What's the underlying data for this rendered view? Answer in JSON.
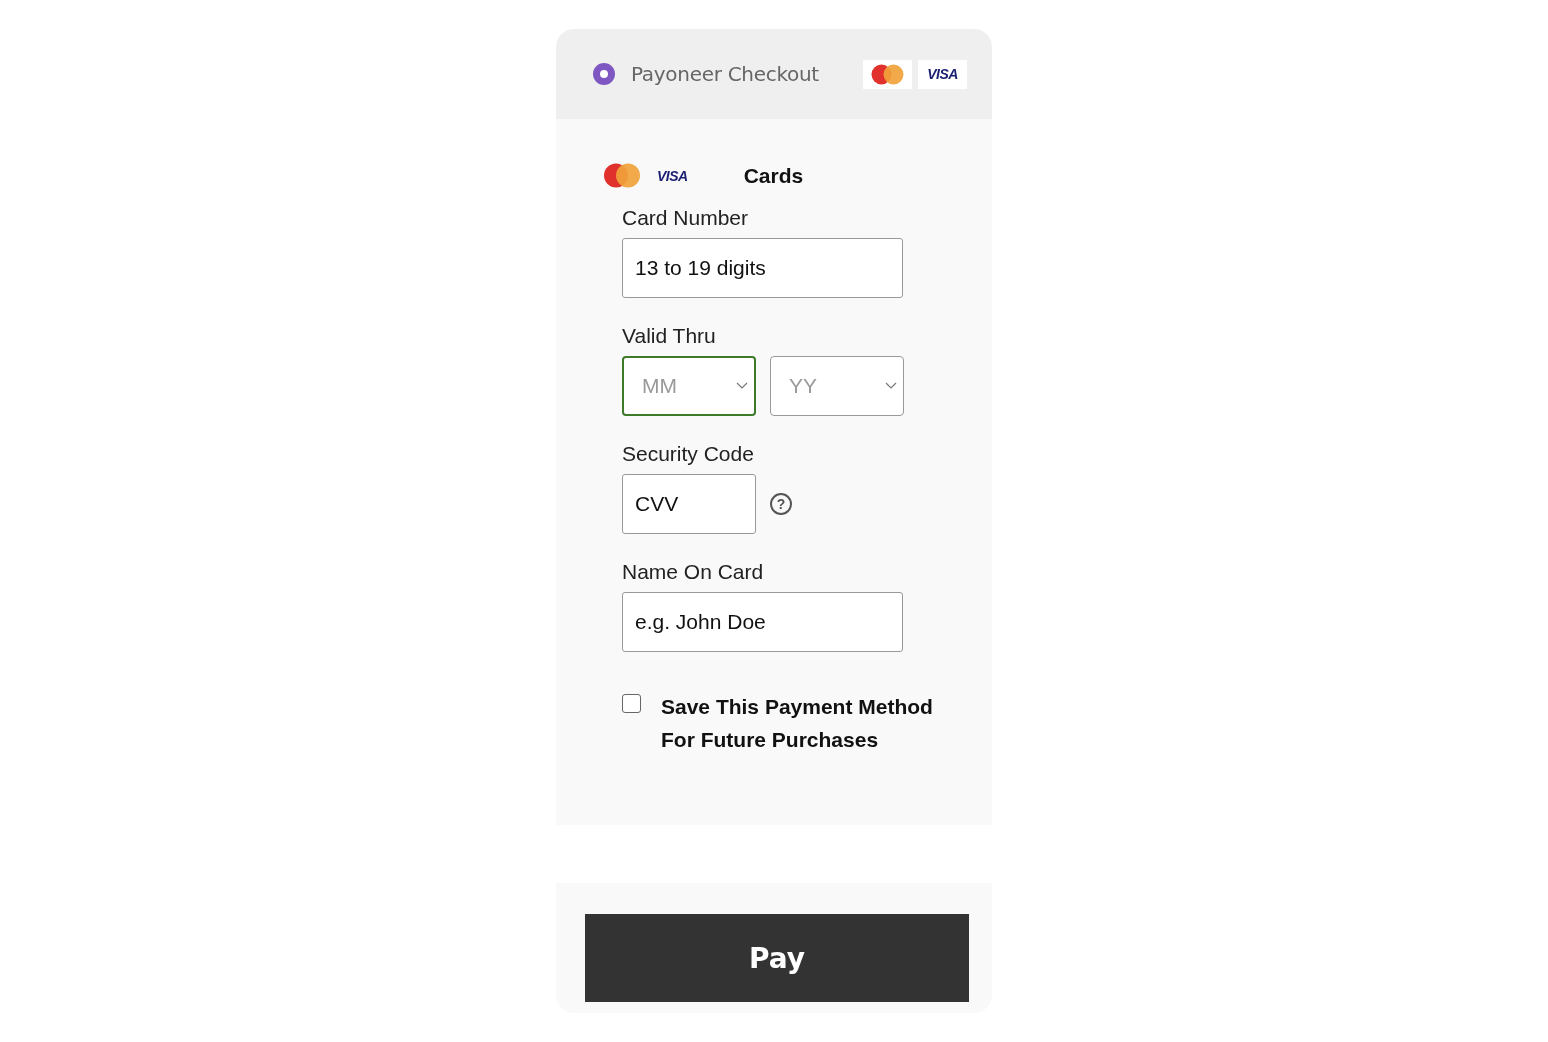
{
  "header": {
    "radio_selected": true,
    "title": "Payoneer Checkout",
    "brands": [
      {
        "kind": "mastercard"
      },
      {
        "kind": "visa",
        "label": "VISA"
      }
    ]
  },
  "method": {
    "brands": [
      {
        "kind": "mastercard"
      },
      {
        "kind": "visa",
        "label": "VISA"
      }
    ],
    "title": "Cards"
  },
  "fields": [
    {
      "kind": "text",
      "label": "Card Number",
      "placeholder": "13 to 19 digits"
    },
    {
      "kind": "expiry",
      "label": "Valid Thru",
      "selects": [
        {
          "placeholder": "MM",
          "focused": true
        },
        {
          "placeholder": "YY",
          "focused": false
        }
      ]
    },
    {
      "kind": "cvv",
      "label": "Security Code",
      "placeholder": "CVV",
      "help": "?"
    },
    {
      "kind": "text",
      "label": "Name On Card",
      "placeholder": "e.g. John Doe"
    }
  ],
  "save": {
    "checked": false,
    "label": "Save This Payment Method For Future Purchases"
  },
  "pay_button": "Pay"
}
